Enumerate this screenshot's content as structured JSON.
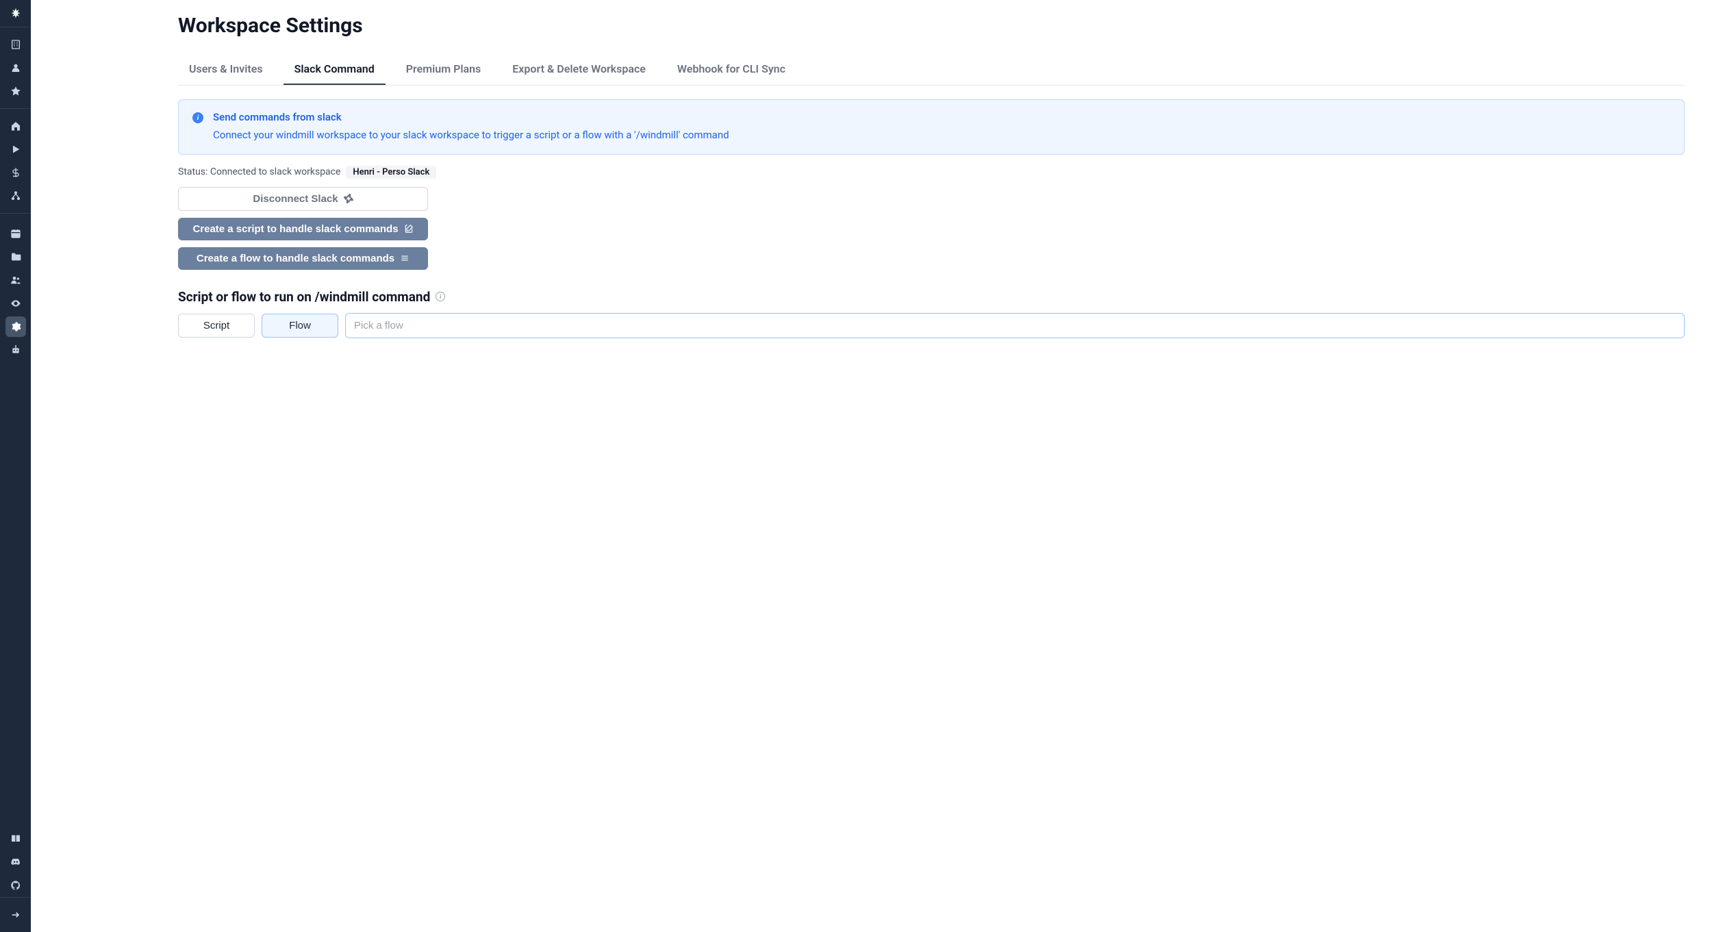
{
  "page_title": "Workspace Settings",
  "tabs": [
    {
      "label": "Users & Invites",
      "active": false
    },
    {
      "label": "Slack Command",
      "active": true
    },
    {
      "label": "Premium Plans",
      "active": false
    },
    {
      "label": "Export & Delete Workspace",
      "active": false
    },
    {
      "label": "Webhook for CLI Sync",
      "active": false
    }
  ],
  "info_banner": {
    "title": "Send commands from slack",
    "description": "Connect your windmill workspace to your slack workspace to trigger a script or a flow with a '/windmill' command"
  },
  "status": {
    "prefix": "Status: Connected to slack workspace",
    "workspace_name": "Henri - Perso Slack"
  },
  "buttons": {
    "disconnect": "Disconnect Slack",
    "create_script": "Create a script to handle slack commands",
    "create_flow": "Create a flow to handle slack commands"
  },
  "section": {
    "header": "Script or flow to run on /windmill command",
    "toggle_script": "Script",
    "toggle_flow": "Flow",
    "picker_placeholder": "Pick a flow"
  },
  "sidebar": {
    "icons": [
      "logo",
      "building",
      "user",
      "star",
      "home",
      "play",
      "dollar",
      "network",
      "calendar",
      "folder",
      "users",
      "eye",
      "gear",
      "robot",
      "book",
      "discord",
      "github",
      "arrow-right"
    ]
  }
}
